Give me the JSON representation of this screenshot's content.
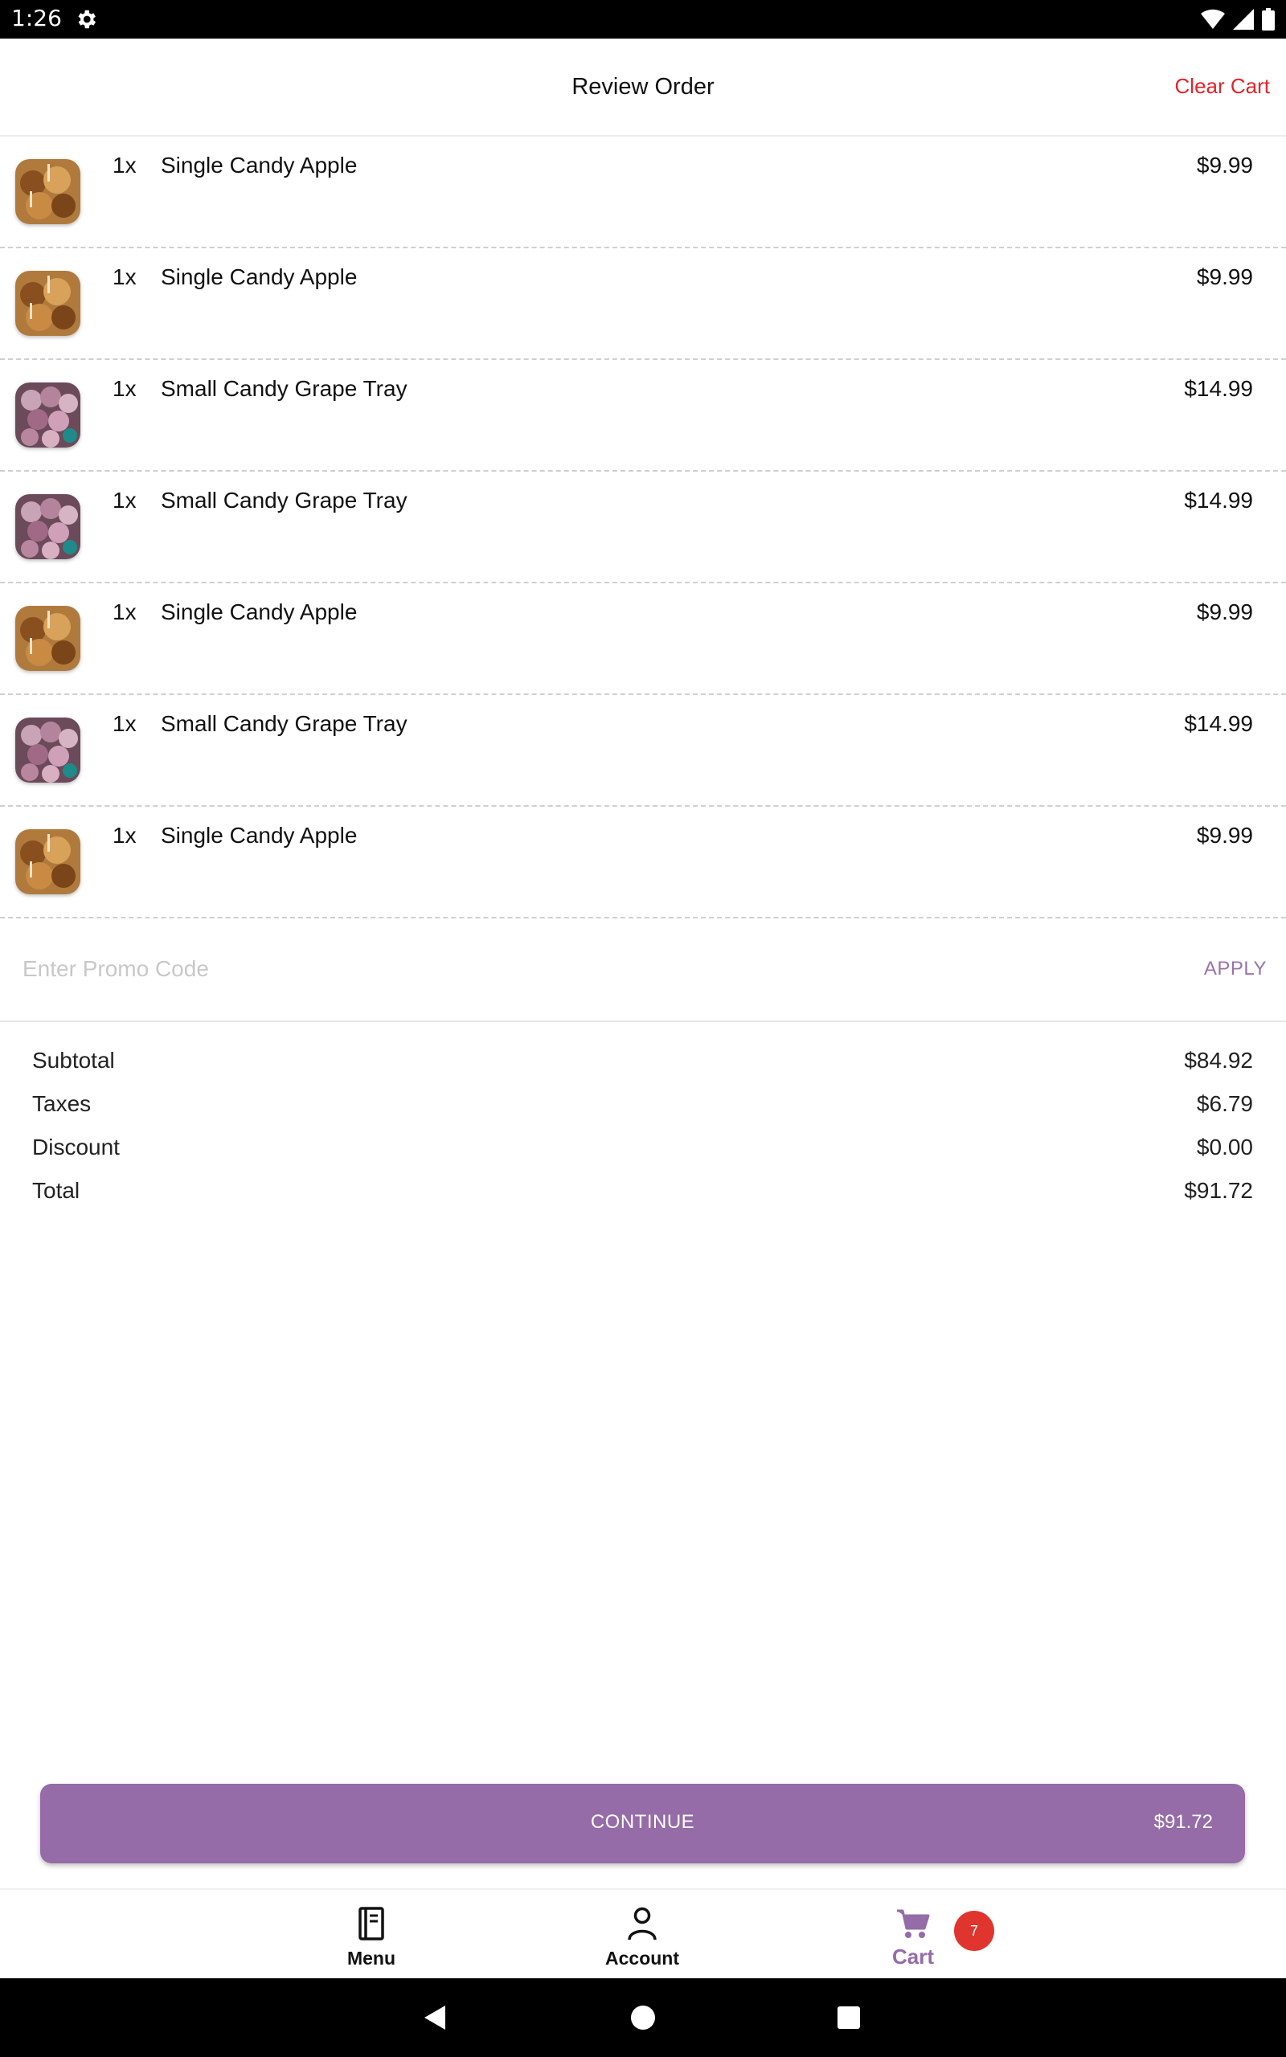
{
  "status_bar": {
    "time": "1:26"
  },
  "header": {
    "title": "Review Order",
    "clear_label": "Clear Cart"
  },
  "items": [
    {
      "qty": "1x",
      "name": "Single Candy Apple",
      "price": "$9.99",
      "image": "candy-apple"
    },
    {
      "qty": "1x",
      "name": "Single Candy Apple",
      "price": "$9.99",
      "image": "candy-apple"
    },
    {
      "qty": "1x",
      "name": "Small Candy Grape Tray",
      "price": "$14.99",
      "image": "candy-grape-tray"
    },
    {
      "qty": "1x",
      "name": "Small Candy Grape Tray",
      "price": "$14.99",
      "image": "candy-grape-tray"
    },
    {
      "qty": "1x",
      "name": "Single Candy Apple",
      "price": "$9.99",
      "image": "candy-apple"
    },
    {
      "qty": "1x",
      "name": "Small Candy Grape Tray",
      "price": "$14.99",
      "image": "candy-grape-tray"
    },
    {
      "qty": "1x",
      "name": "Single Candy Apple",
      "price": "$9.99",
      "image": "candy-apple"
    }
  ],
  "promo": {
    "placeholder": "Enter Promo Code",
    "value": "",
    "apply_label": "APPLY"
  },
  "totals": [
    {
      "label": "Subtotal",
      "value": "$84.92"
    },
    {
      "label": "Taxes",
      "value": "$6.79"
    },
    {
      "label": "Discount",
      "value": "$0.00"
    },
    {
      "label": "Total",
      "value": "$91.72"
    }
  ],
  "continue_button": {
    "label": "CONTINUE",
    "amount": "$91.72"
  },
  "tabs": [
    {
      "label": "Menu",
      "icon": "menu-book-icon"
    },
    {
      "label": "Account",
      "icon": "person-icon"
    },
    {
      "label": "Cart",
      "icon": "cart-icon",
      "badge": "7",
      "active": true
    }
  ],
  "colors": {
    "accent": "#956ba8",
    "danger": "#e0252b",
    "badge": "#e0352f"
  }
}
